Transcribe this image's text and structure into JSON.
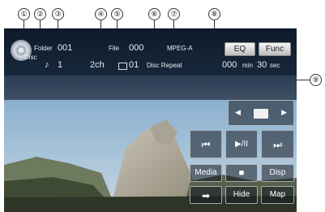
{
  "callouts": [
    "①",
    "②",
    "③",
    "④",
    "⑤",
    "⑥",
    "⑦",
    "⑧",
    "⑨"
  ],
  "status": {
    "folder_label": "Folder",
    "folder_value": "001",
    "file_label": "File",
    "file_value": "000",
    "format": "MPEG-A",
    "chapter": "1",
    "audio_channel": "2ch",
    "subtitle_value": "01",
    "repeat_mode": "Disc Repeat",
    "time_minutes": "000",
    "time_min_unit": "min",
    "time_seconds": "30",
    "time_sec_unit": "sec",
    "disc_caption": "Disc"
  },
  "buttons": {
    "eq": "EQ",
    "func": "Func",
    "media": "Media",
    "disp": "Disp",
    "hide": "Hide",
    "map": "Map"
  },
  "icons": {
    "prev_folder": "◀",
    "next_folder": "▶",
    "skip_back": "⏮",
    "play_pause": "▶/II",
    "skip_forward": "⏭",
    "stop": "■",
    "arrow": "➡"
  }
}
